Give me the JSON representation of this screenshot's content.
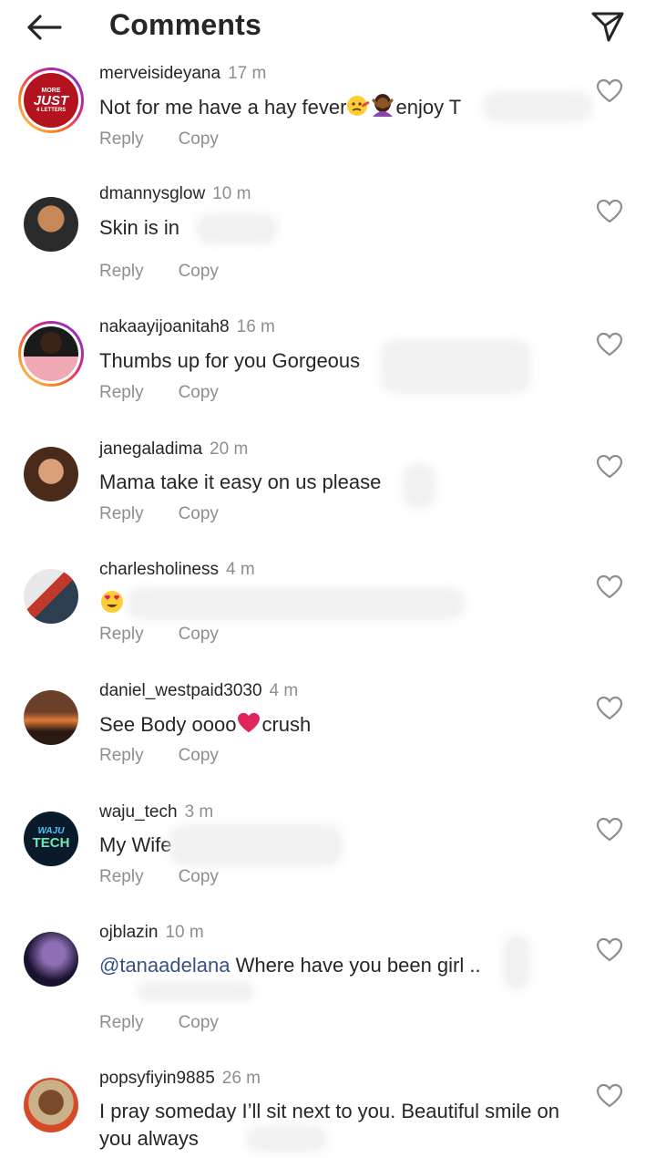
{
  "header": {
    "title": "Comments"
  },
  "actions": {
    "reply": "Reply",
    "copy": "Copy"
  },
  "comments": [
    {
      "username": "merveisideyana",
      "time": "17 m",
      "text": "Not for me have a hay fever",
      "text_after": "enjoy T"
    },
    {
      "username": "dmannysglow",
      "time": "10 m",
      "text": "Skin is in"
    },
    {
      "username": "nakaayijoanitah8",
      "time": "16 m",
      "text": "Thumbs up for you Gorgeous"
    },
    {
      "username": "janegaladima",
      "time": "20 m",
      "text": "Mama take it easy on us please"
    },
    {
      "username": "charlesholiness",
      "time": "4 m",
      "text": ""
    },
    {
      "username": "daniel_westpaid3030",
      "time": "4 m",
      "text": "See Body oooo",
      "text_after": "crush"
    },
    {
      "username": "waju_tech",
      "time": "3 m",
      "text": "My Wife"
    },
    {
      "username": "ojblazin",
      "time": "10 m",
      "mention": "@tanaadelana",
      "text": " Where have you been girl .."
    },
    {
      "username": "popsyfiyin9885",
      "time": "26 m",
      "text": "I pray someday I’ll sit next to you. Beautiful smile on you always"
    }
  ],
  "avatars": {
    "c0": {
      "line1": "MORE",
      "line2": "JUST",
      "line3": "4 LETTERS"
    },
    "c6": {
      "line1": "WAJU",
      "line2": "TECH"
    }
  }
}
